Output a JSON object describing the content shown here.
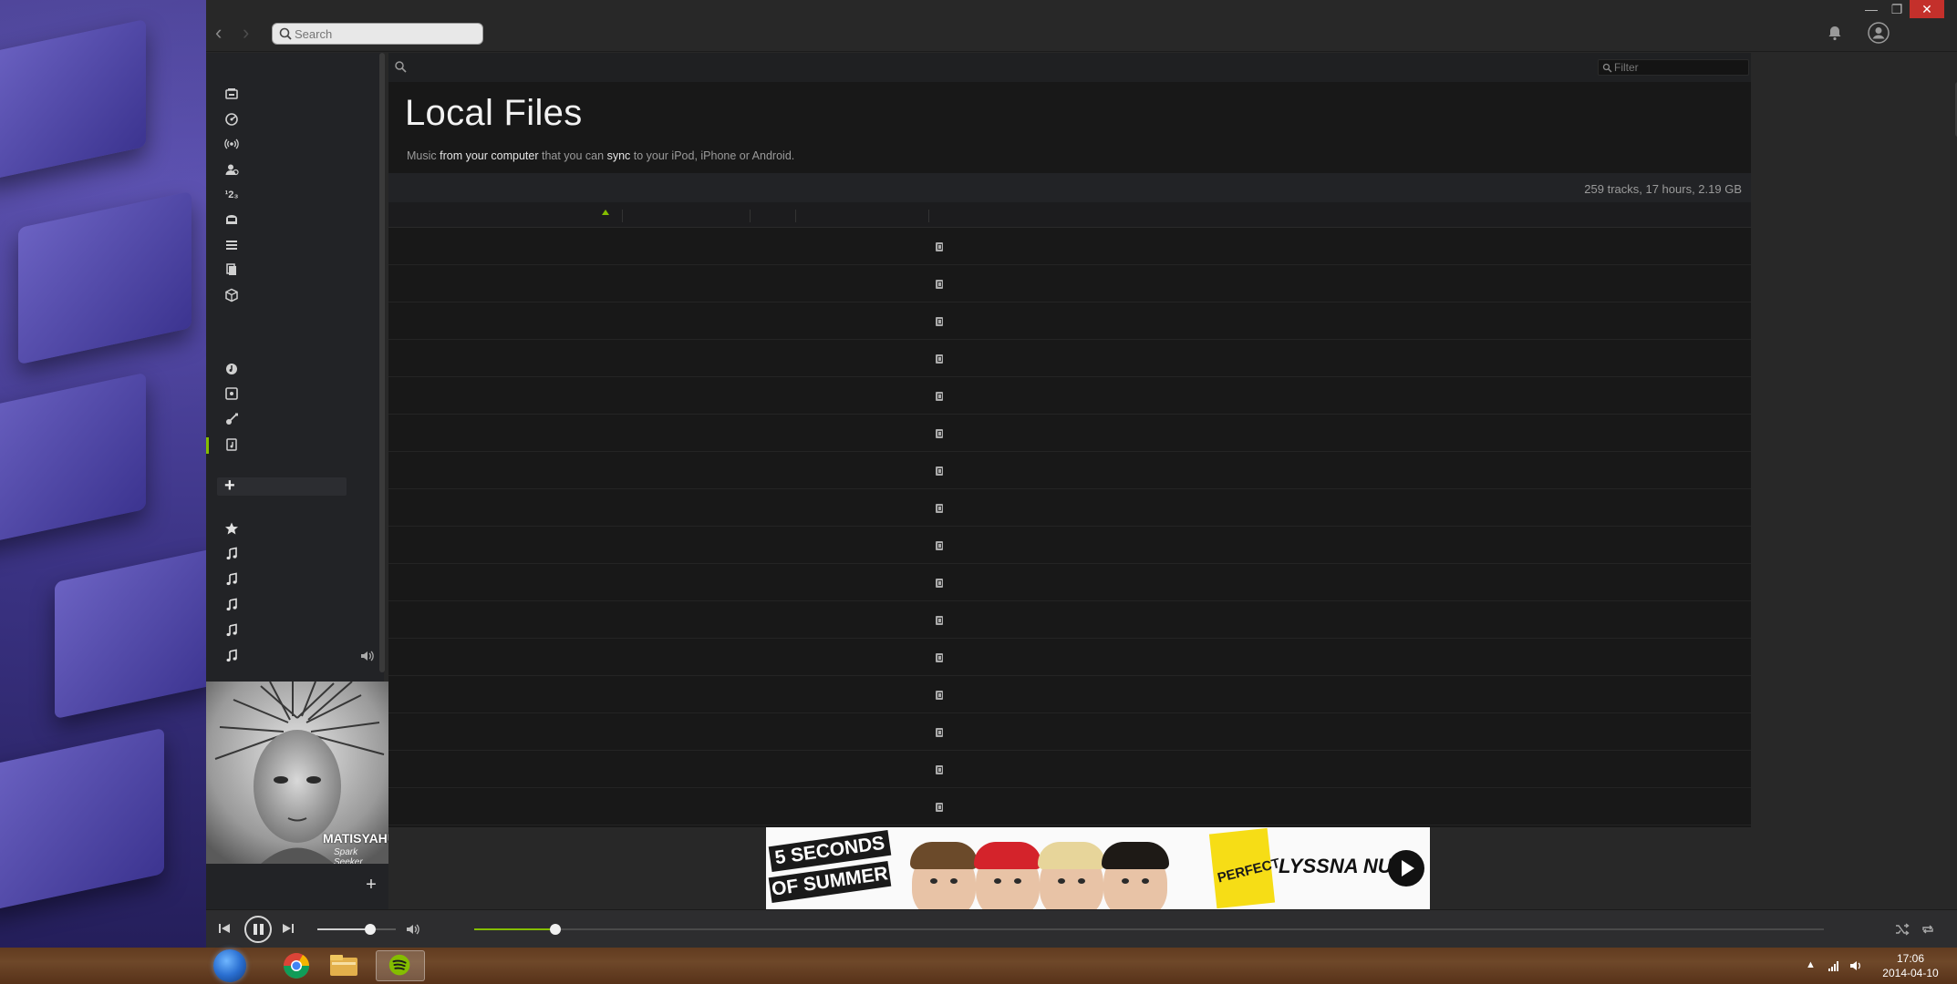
{
  "window": {
    "search_placeholder": "Search",
    "minimize_glyph": "—",
    "restore_glyph": "❐",
    "close_glyph": "✕"
  },
  "main": {
    "filter_placeholder": "Filter",
    "title": "Local Files",
    "subtitle": {
      "p1": "Music ",
      "b1": "from your computer",
      "p2": " that you can ",
      "b2": "sync",
      "p3": " to your iPod, iPhone or Android."
    },
    "stats": "259 tracks, 17 hours, 2.19 GB",
    "visible_rows": 16
  },
  "sidebar": {
    "main_icons": [
      "inbox-icon",
      "radar-icon",
      "radio-icon",
      "follow-icon",
      "top-lists-icon",
      "messages-icon",
      "playlists-icon",
      "albums-icon",
      "apps-icon"
    ],
    "library_icons": [
      "music-icon",
      "disc-icon",
      "guitar-icon",
      "local-files-icon"
    ],
    "playlist_icons": [
      "starred-icon",
      "note-icon",
      "note-icon",
      "note-icon",
      "note-icon",
      "note-icon"
    ],
    "new_playlist_glyph": "+",
    "cover_add_glyph": "+"
  },
  "cover": {
    "artist_text": "MATISYAHU",
    "album_text": "Spark Seeker"
  },
  "ad": {
    "band_line1": "5 SECONDS",
    "band_line2": "OF SUMMER",
    "tag_text": "PERFECT",
    "cta": "LYSSNA NU"
  },
  "player": {
    "volume": 0.68,
    "progress": 0.06
  },
  "taskbar": {
    "time": "17:06",
    "date": "2014-04-10"
  },
  "colors": {
    "accent": "#84bd00",
    "close": "#c4302b"
  }
}
